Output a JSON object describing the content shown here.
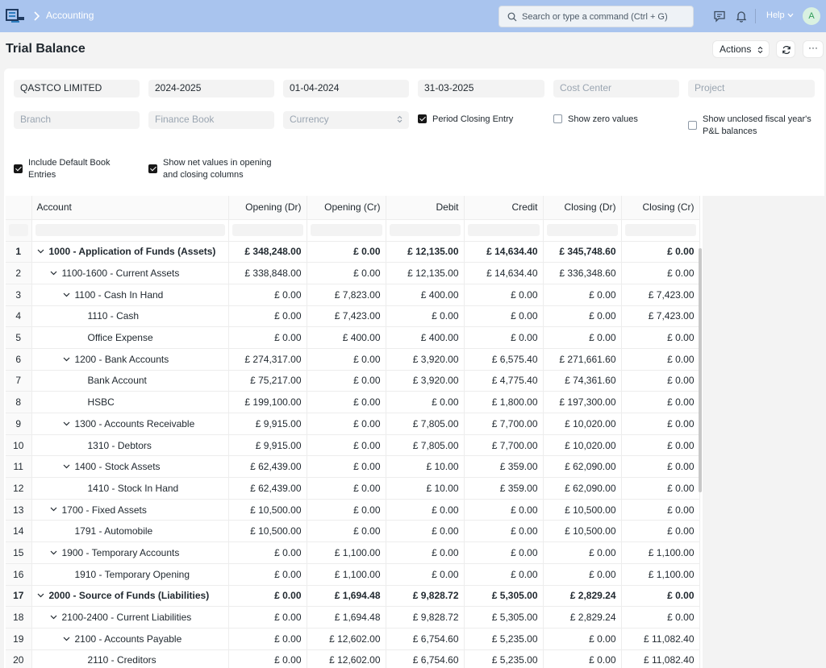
{
  "navbar": {
    "breadcrumb": "Accounting",
    "search_placeholder": "Search or type a command (Ctrl + G)",
    "help_label": "Help",
    "avatar_initial": "A",
    "bg_color": "#a9c4ee"
  },
  "page": {
    "title": "Trial Balance",
    "actions_label": "Actions",
    "more_label": "···"
  },
  "filters": {
    "company": "QASTCO LIMITED",
    "fiscal_year": "2024-2025",
    "from_date": "01-04-2024",
    "to_date": "31-03-2025",
    "cost_center_placeholder": "Cost Center",
    "project_placeholder": "Project",
    "branch_placeholder": "Branch",
    "finance_book_placeholder": "Finance Book",
    "currency_placeholder": "Currency",
    "period_closing_entry": {
      "label": "Period Closing Entry",
      "checked": true
    },
    "show_zero_values": {
      "label": "Show zero values",
      "checked": false
    },
    "show_unclosed_line1": "Show unclosed fiscal year's",
    "show_unclosed_line2": "P&L balances",
    "show_unclosed_checked": false,
    "include_default_line1": "Include Default Book",
    "include_default_line2": "Entries",
    "include_default_checked": true,
    "show_net_line1": "Show net values in opening",
    "show_net_line2": "and closing columns",
    "show_net_checked": true
  },
  "table": {
    "columns": [
      "Account",
      "Opening (Dr)",
      "Opening (Cr)",
      "Debit",
      "Credit",
      "Closing (Dr)",
      "Closing (Cr)"
    ],
    "rows": [
      {
        "n": "1",
        "indent": 0,
        "toggle": true,
        "bold": true,
        "account": "1000 - Application of Funds (Assets)",
        "od": "£ 348,248.00",
        "oc": "£ 0.00",
        "dr": "£ 12,135.00",
        "cr": "£ 14,634.40",
        "cd": "£ 345,748.60",
        "cc": "£ 0.00"
      },
      {
        "n": "2",
        "indent": 1,
        "toggle": true,
        "bold": false,
        "account": "1100-1600 - Current Assets",
        "od": "£ 338,848.00",
        "oc": "£ 0.00",
        "dr": "£ 12,135.00",
        "cr": "£ 14,634.40",
        "cd": "£ 336,348.60",
        "cc": "£ 0.00"
      },
      {
        "n": "3",
        "indent": 2,
        "toggle": true,
        "bold": false,
        "account": "1100 - Cash In Hand",
        "od": "£ 0.00",
        "oc": "£ 7,823.00",
        "dr": "£ 400.00",
        "cr": "£ 0.00",
        "cd": "£ 0.00",
        "cc": "£ 7,423.00"
      },
      {
        "n": "4",
        "indent": 3,
        "toggle": false,
        "bold": false,
        "account": "1110 - Cash",
        "od": "£ 0.00",
        "oc": "£ 7,423.00",
        "dr": "£ 0.00",
        "cr": "£ 0.00",
        "cd": "£ 0.00",
        "cc": "£ 7,423.00"
      },
      {
        "n": "5",
        "indent": 3,
        "toggle": false,
        "bold": false,
        "account": "Office Expense",
        "od": "£ 0.00",
        "oc": "£ 400.00",
        "dr": "£ 400.00",
        "cr": "£ 0.00",
        "cd": "£ 0.00",
        "cc": "£ 0.00"
      },
      {
        "n": "6",
        "indent": 2,
        "toggle": true,
        "bold": false,
        "account": "1200 - Bank Accounts",
        "od": "£ 274,317.00",
        "oc": "£ 0.00",
        "dr": "£ 3,920.00",
        "cr": "£ 6,575.40",
        "cd": "£ 271,661.60",
        "cc": "£ 0.00"
      },
      {
        "n": "7",
        "indent": 3,
        "toggle": false,
        "bold": false,
        "account": "Bank Account",
        "od": "£ 75,217.00",
        "oc": "£ 0.00",
        "dr": "£ 3,920.00",
        "cr": "£ 4,775.40",
        "cd": "£ 74,361.60",
        "cc": "£ 0.00"
      },
      {
        "n": "8",
        "indent": 3,
        "toggle": false,
        "bold": false,
        "account": "HSBC",
        "od": "£ 199,100.00",
        "oc": "£ 0.00",
        "dr": "£ 0.00",
        "cr": "£ 1,800.00",
        "cd": "£ 197,300.00",
        "cc": "£ 0.00"
      },
      {
        "n": "9",
        "indent": 2,
        "toggle": true,
        "bold": false,
        "account": "1300 - Accounts Receivable",
        "od": "£ 9,915.00",
        "oc": "£ 0.00",
        "dr": "£ 7,805.00",
        "cr": "£ 7,700.00",
        "cd": "£ 10,020.00",
        "cc": "£ 0.00"
      },
      {
        "n": "10",
        "indent": 3,
        "toggle": false,
        "bold": false,
        "account": "1310 - Debtors",
        "od": "£ 9,915.00",
        "oc": "£ 0.00",
        "dr": "£ 7,805.00",
        "cr": "£ 7,700.00",
        "cd": "£ 10,020.00",
        "cc": "£ 0.00"
      },
      {
        "n": "11",
        "indent": 2,
        "toggle": true,
        "bold": false,
        "account": "1400 - Stock Assets",
        "od": "£ 62,439.00",
        "oc": "£ 0.00",
        "dr": "£ 10.00",
        "cr": "£ 359.00",
        "cd": "£ 62,090.00",
        "cc": "£ 0.00"
      },
      {
        "n": "12",
        "indent": 3,
        "toggle": false,
        "bold": false,
        "account": "1410 - Stock In Hand",
        "od": "£ 62,439.00",
        "oc": "£ 0.00",
        "dr": "£ 10.00",
        "cr": "£ 359.00",
        "cd": "£ 62,090.00",
        "cc": "£ 0.00"
      },
      {
        "n": "13",
        "indent": 1,
        "toggle": true,
        "bold": false,
        "account": "1700 - Fixed Assets",
        "od": "£ 10,500.00",
        "oc": "£ 0.00",
        "dr": "£ 0.00",
        "cr": "£ 0.00",
        "cd": "£ 10,500.00",
        "cc": "£ 0.00"
      },
      {
        "n": "14",
        "indent": 2,
        "toggle": false,
        "bold": false,
        "account": "1791 - Automobile",
        "od": "£ 10,500.00",
        "oc": "£ 0.00",
        "dr": "£ 0.00",
        "cr": "£ 0.00",
        "cd": "£ 10,500.00",
        "cc": "£ 0.00"
      },
      {
        "n": "15",
        "indent": 1,
        "toggle": true,
        "bold": false,
        "account": "1900 - Temporary Accounts",
        "od": "£ 0.00",
        "oc": "£ 1,100.00",
        "dr": "£ 0.00",
        "cr": "£ 0.00",
        "cd": "£ 0.00",
        "cc": "£ 1,100.00"
      },
      {
        "n": "16",
        "indent": 2,
        "toggle": false,
        "bold": false,
        "account": "1910 - Temporary Opening",
        "od": "£ 0.00",
        "oc": "£ 1,100.00",
        "dr": "£ 0.00",
        "cr": "£ 0.00",
        "cd": "£ 0.00",
        "cc": "£ 1,100.00"
      },
      {
        "n": "17",
        "indent": 0,
        "toggle": true,
        "bold": true,
        "account": "2000 - Source of Funds (Liabilities)",
        "od": "£ 0.00",
        "oc": "£ 1,694.48",
        "dr": "£ 9,828.72",
        "cr": "£ 5,305.00",
        "cd": "£ 2,829.24",
        "cc": "£ 0.00"
      },
      {
        "n": "18",
        "indent": 1,
        "toggle": true,
        "bold": false,
        "account": "2100-2400 - Current Liabilities",
        "od": "£ 0.00",
        "oc": "£ 1,694.48",
        "dr": "£ 9,828.72",
        "cr": "£ 5,305.00",
        "cd": "£ 2,829.24",
        "cc": "£ 0.00"
      },
      {
        "n": "19",
        "indent": 2,
        "toggle": true,
        "bold": false,
        "account": "2100 - Accounts Payable",
        "od": "£ 0.00",
        "oc": "£ 12,602.00",
        "dr": "£ 6,754.60",
        "cr": "£ 5,235.00",
        "cd": "£ 0.00",
        "cc": "£ 11,082.40"
      },
      {
        "n": "20",
        "indent": 3,
        "toggle": false,
        "bold": false,
        "account": "2110 - Creditors",
        "od": "£ 0.00",
        "oc": "£ 12,602.00",
        "dr": "£ 6,754.60",
        "cr": "£ 5,235.00",
        "cd": "£ 0.00",
        "cc": "£ 11,082.40"
      }
    ]
  }
}
